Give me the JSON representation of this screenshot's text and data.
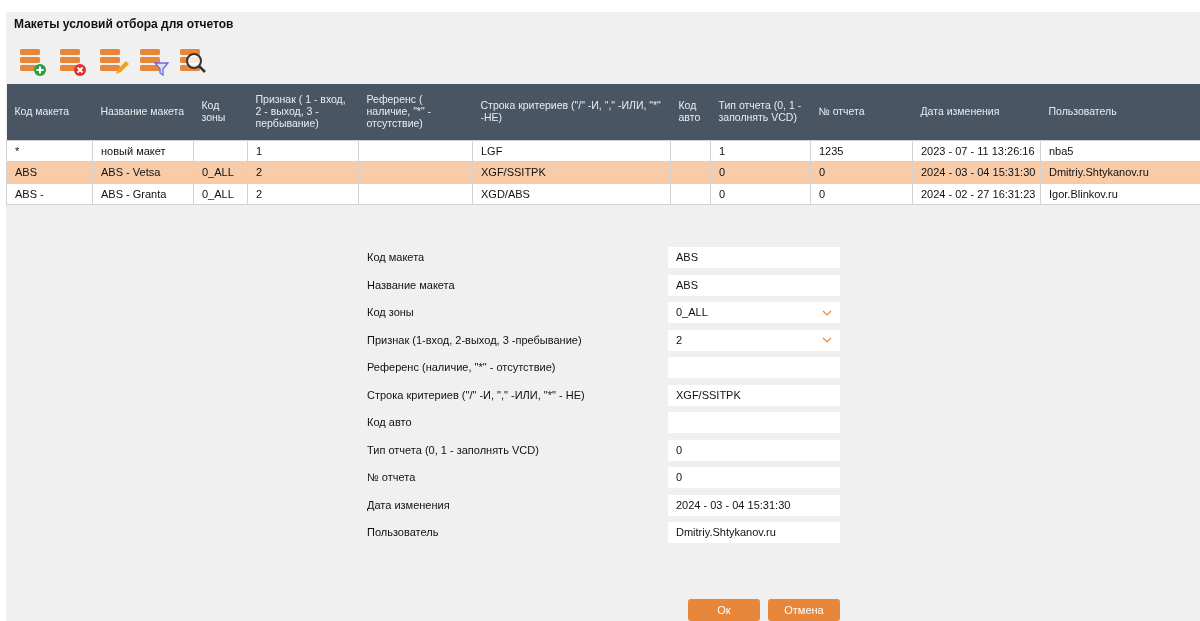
{
  "title": "Макеты условий отбора для отчетов",
  "toolbar": [
    {
      "kind": "add"
    },
    {
      "kind": "delete"
    },
    {
      "kind": "edit"
    },
    {
      "kind": "filter"
    },
    {
      "kind": "search"
    }
  ],
  "table": {
    "columns": [
      "Код макета",
      "Название макета",
      "Код зоны",
      "Признак ( 1 - вход, 2 - выход, 3 - пербывание)",
      "Референс ( наличие, \"*\" - отсутствие)",
      "Строка критериев (\"/\" -И, \",\" -ИЛИ, \"*\" -НЕ)",
      "Код авто",
      "Тип отчета (0, 1 - заполнять VCD)",
      "№ отчета",
      "Дата изменения",
      "Пользователь"
    ],
    "rows": [
      {
        "selected": false,
        "cells": [
          "*",
          "новый макет",
          "",
          "1",
          "",
          "LGF",
          "",
          "1",
          "1235",
          "2023 - 07 - 11 13:26:16",
          "nba5"
        ]
      },
      {
        "selected": true,
        "cells": [
          "ABS",
          "ABS - Vetsa",
          "0_ALL",
          "2",
          "",
          "XGF/SSITPK",
          "",
          "0",
          "0",
          "2024 - 03 - 04 15:31:30",
          "Dmitriy.Shtykanov.ru"
        ]
      },
      {
        "selected": false,
        "cells": [
          "ABS -",
          "ABS - Granta",
          "0_ALL",
          "2",
          "",
          "XGD/ABS",
          "",
          "0",
          "0",
          "2024 - 02 - 27 16:31:23",
          "Igor.Blinkov.ru"
        ]
      }
    ]
  },
  "form": {
    "fields": [
      {
        "label": "Код макета",
        "kind": "text",
        "value": "ABS"
      },
      {
        "label": "Название макета",
        "kind": "text",
        "value": "ABS"
      },
      {
        "label": "Код зоны",
        "kind": "select",
        "value": "0_ALL"
      },
      {
        "label": "Признак (1-вход, 2-выход, 3 -пребывание)",
        "kind": "select",
        "value": "2"
      },
      {
        "label": "Референс (наличие, \"*\" - отсутствие)",
        "kind": "text"
      },
      {
        "label": "Строка критериев (\"/\" -И, \",\" -ИЛИ, \"*\" - НЕ)",
        "kind": "text",
        "value": "XGF/SSITPK"
      },
      {
        "label": "Код авто",
        "kind": "text"
      },
      {
        "label": "Тип отчета (0, 1 - заполнять VCD)",
        "kind": "text",
        "value": "0"
      },
      {
        "label": "№ отчета",
        "kind": "text",
        "value": "0"
      },
      {
        "label": "Дата изменения",
        "kind": "text",
        "value": "2024 - 03 - 04 15:31:30"
      },
      {
        "label": "Пользователь",
        "kind": "text",
        "value": "Dmitriy.Shtykanov.ru"
      }
    ],
    "buttons": [
      "Ок",
      "Отмена"
    ]
  }
}
